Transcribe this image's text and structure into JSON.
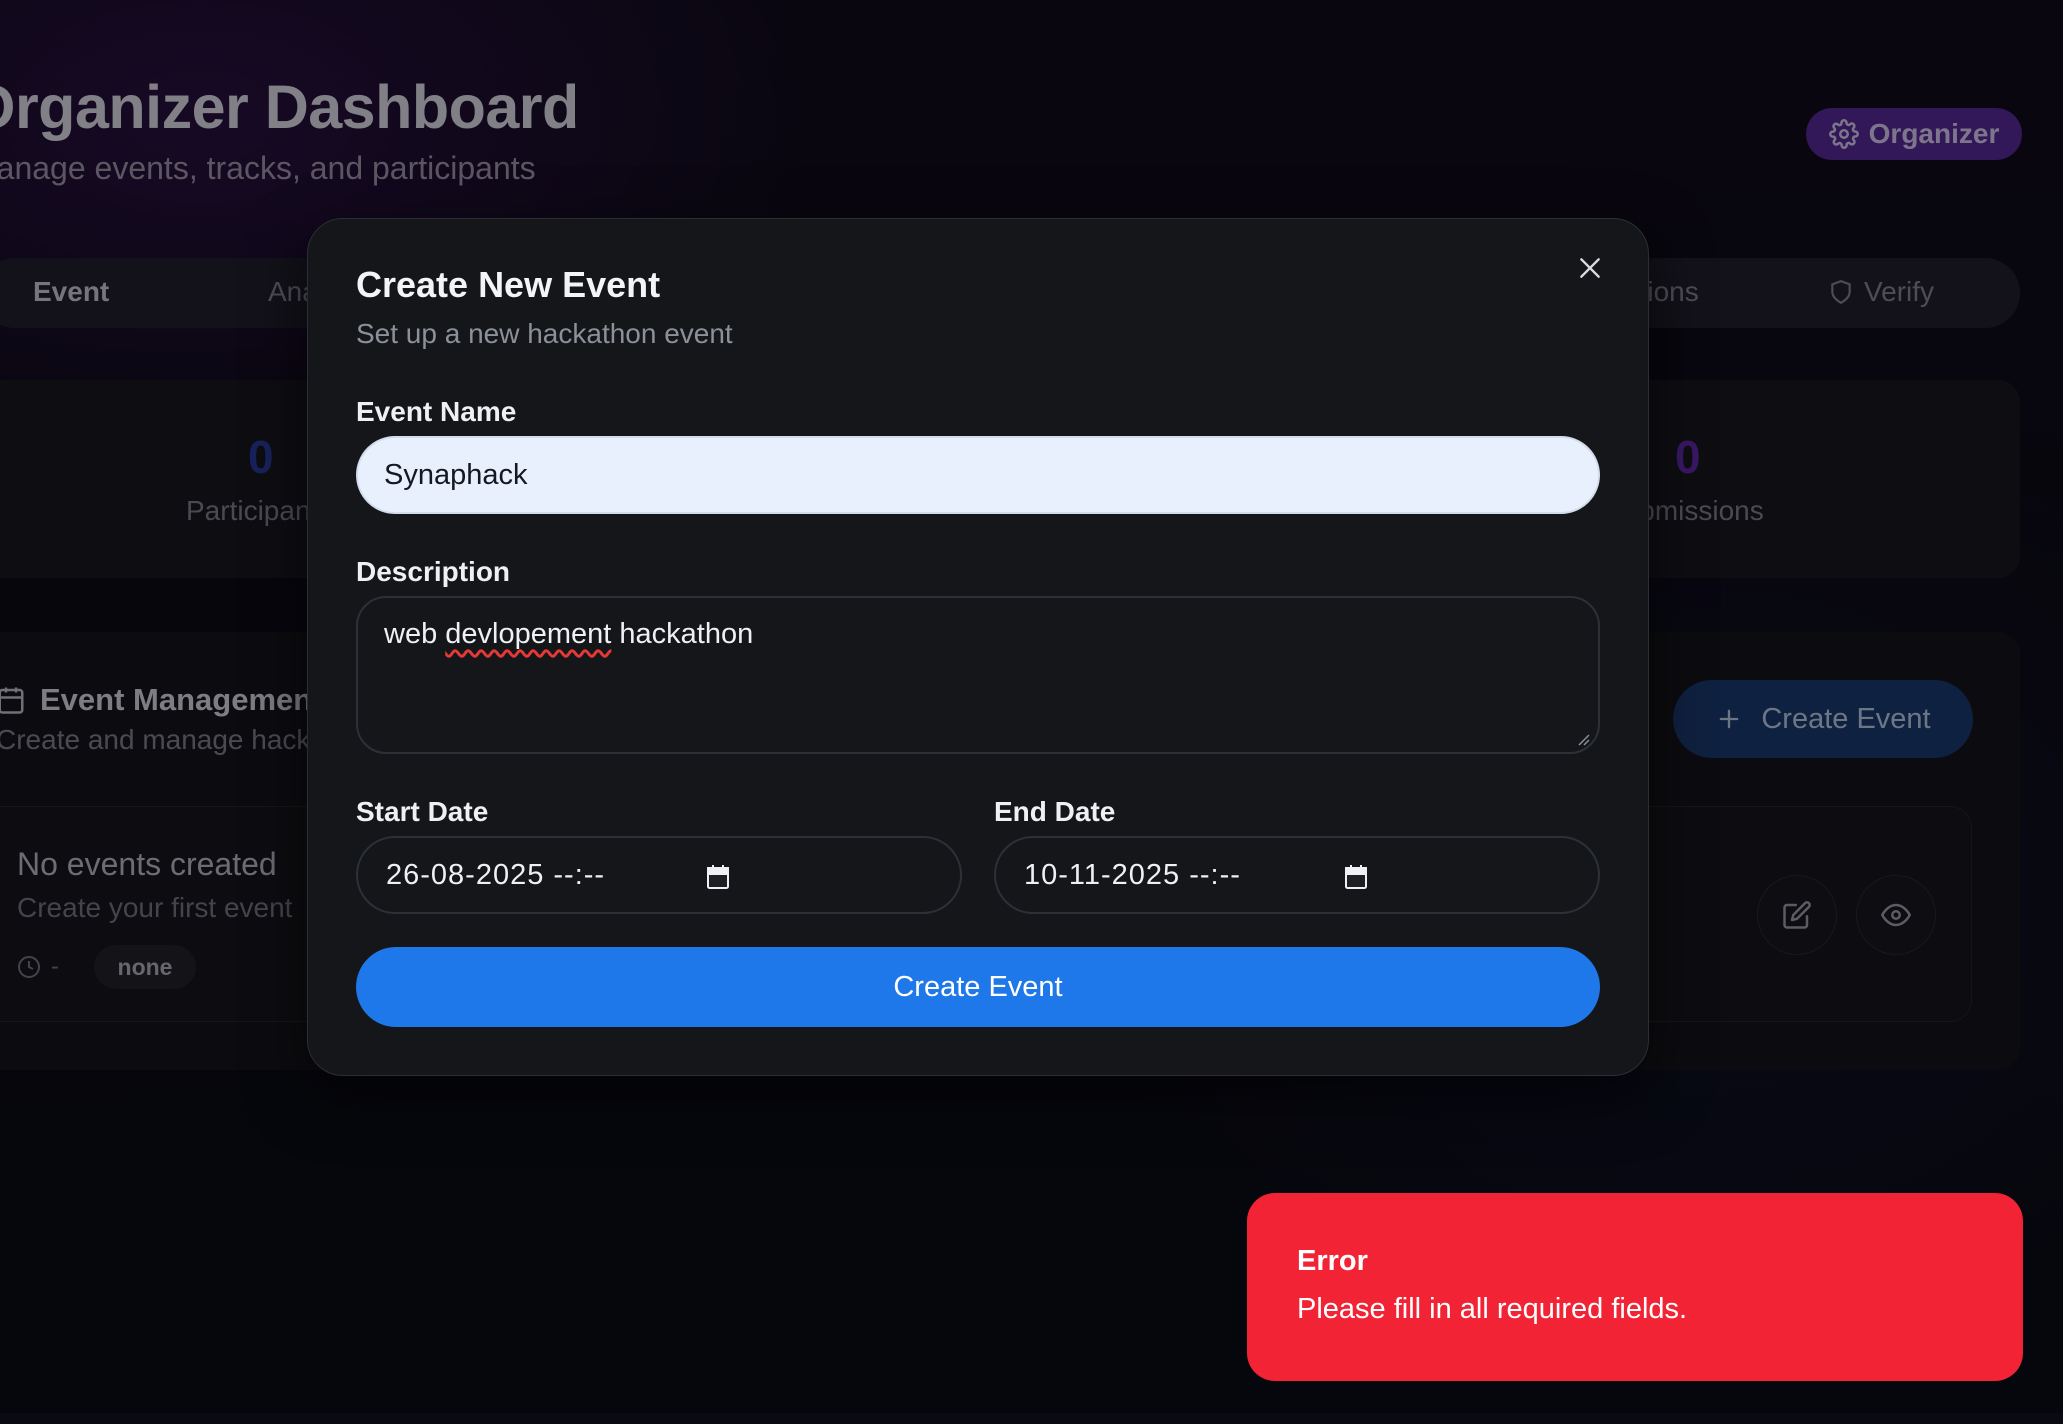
{
  "dashboard": {
    "title": "Organizer Dashboard",
    "subtitle": "Manage events, tracks, and participants",
    "role_badge": "Organizer",
    "tabs": [
      {
        "label": "Event"
      },
      {
        "label": "Analytics"
      },
      {
        "label": "Submissions"
      },
      {
        "label": "Verify"
      }
    ],
    "stats": [
      {
        "value": "0",
        "label": "Participants",
        "color": "#2a3fa8"
      },
      {
        "value": "0",
        "label": "Submissions",
        "color": "#6a2bb8"
      }
    ],
    "event_management": {
      "title": "Event Management",
      "subtitle": "Create and manage hackathons",
      "create_button": "Create Event"
    },
    "event_card": {
      "title": "No events created",
      "subtitle": "Create your first event",
      "time": "-",
      "status": "none"
    }
  },
  "modal": {
    "title": "Create New Event",
    "subtitle": "Set up a new hackathon event",
    "fields": {
      "event_name": {
        "label": "Event Name",
        "value": "Synaphack"
      },
      "description": {
        "label": "Description",
        "value_prefix": "web ",
        "value_misspelled": "devlopement",
        "value_suffix": " hackathon"
      },
      "start_date": {
        "label": "Start Date",
        "value": "26-08-2025 --:--"
      },
      "end_date": {
        "label": "End Date",
        "value": "10-11-2025 --:--"
      }
    },
    "submit_label": "Create Event"
  },
  "toast": {
    "title": "Error",
    "message": "Please fill in all required fields.",
    "color": "#f12334"
  },
  "icons": {
    "close": "close-icon",
    "calendar": "calendar-icon",
    "gear": "gear-icon",
    "plus": "plus-icon",
    "edit": "edit-icon",
    "eye": "eye-icon",
    "clock": "clock-icon",
    "shield": "shield-icon"
  }
}
